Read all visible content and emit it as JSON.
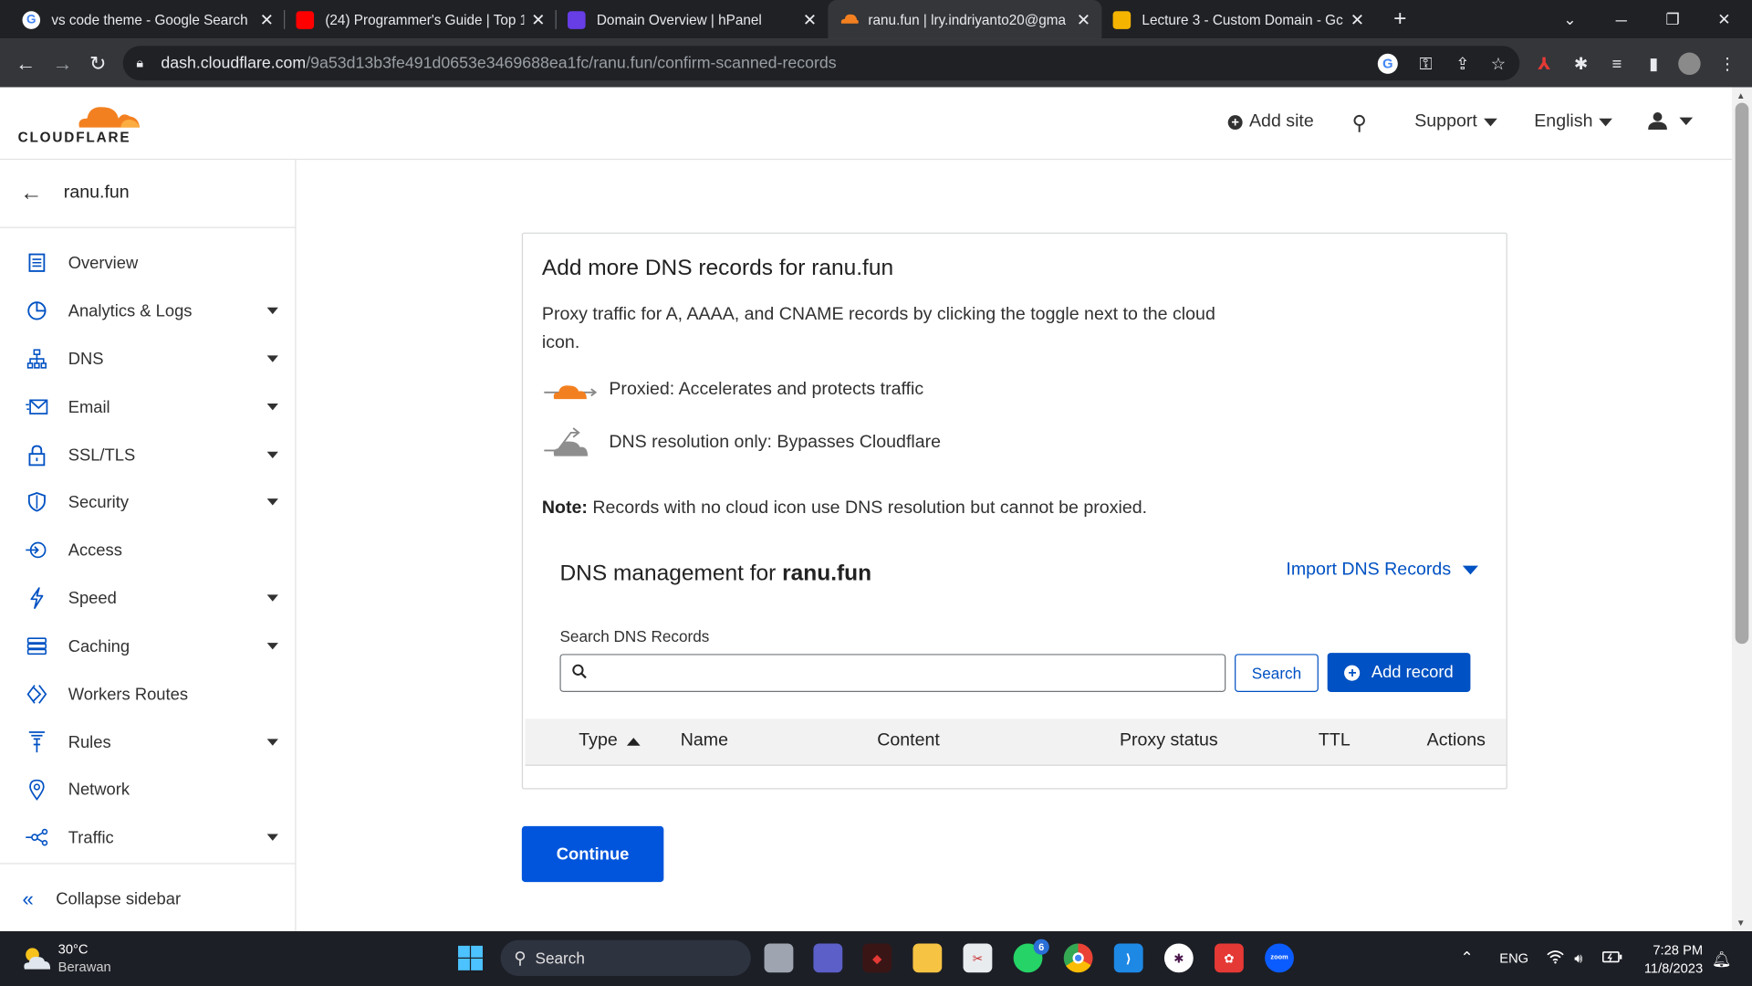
{
  "browser": {
    "tabs": [
      {
        "title": "vs code theme - Google Search",
        "icon": "google-icon",
        "color": "#ffffff"
      },
      {
        "title": "(24) Programmer's Guide | Top 1",
        "icon": "youtube-icon",
        "color": "#ff0000"
      },
      {
        "title": "Domain Overview | hPanel",
        "icon": "hostinger-icon",
        "color": "#673de6"
      },
      {
        "title": "ranu.fun | lry.indriyanto20@gma",
        "icon": "cloudflare-icon",
        "color": "#f38020",
        "active": true
      },
      {
        "title": "Lecture 3 - Custom Domain - Gc",
        "icon": "slides-icon",
        "color": "#f4b400"
      }
    ],
    "url_domain": "dash.cloudflare.com",
    "url_path": "/9a53d13b3fe491d0653e3469688ea1fc/ranu.fun/confirm-scanned-records"
  },
  "header": {
    "logo_text": "CLOUDFLARE",
    "add_site": "Add site",
    "support": "Support",
    "language": "English"
  },
  "sidebar": {
    "site": "ranu.fun",
    "items": [
      {
        "label": "Overview",
        "icon": "overview-icon",
        "dropdown": false
      },
      {
        "label": "Analytics & Logs",
        "icon": "analytics-icon",
        "dropdown": true
      },
      {
        "label": "DNS",
        "icon": "dns-icon",
        "dropdown": true
      },
      {
        "label": "Email",
        "icon": "email-icon",
        "dropdown": true
      },
      {
        "label": "SSL/TLS",
        "icon": "lock-icon",
        "dropdown": true
      },
      {
        "label": "Security",
        "icon": "shield-icon",
        "dropdown": true
      },
      {
        "label": "Access",
        "icon": "access-icon",
        "dropdown": false
      },
      {
        "label": "Speed",
        "icon": "bolt-icon",
        "dropdown": true
      },
      {
        "label": "Caching",
        "icon": "caching-icon",
        "dropdown": true
      },
      {
        "label": "Workers Routes",
        "icon": "workers-icon",
        "dropdown": false
      },
      {
        "label": "Rules",
        "icon": "rules-icon",
        "dropdown": true
      },
      {
        "label": "Network",
        "icon": "location-pin-icon",
        "dropdown": false
      },
      {
        "label": "Traffic",
        "icon": "traffic-icon",
        "dropdown": true
      }
    ],
    "collapse": "Collapse sidebar"
  },
  "main": {
    "title": "Add more DNS records for ranu.fun",
    "description": "Proxy traffic for A, AAAA, and CNAME records by clicking the toggle next to the cloud icon.",
    "proxied": "Proxied: Accelerates and protects traffic",
    "dns_only": "DNS resolution only: Bypasses Cloudflare",
    "note_label": "Note:",
    "note_text": " Records with no cloud icon use DNS resolution but cannot be proxied.",
    "dns_mgmt_prefix": "DNS management for ",
    "dns_mgmt_domain": "ranu.fun",
    "import": "Import DNS Records",
    "search_label": "Search DNS Records",
    "search_value": "",
    "search_button": "Search",
    "add_record": "Add record",
    "columns": [
      "Type",
      "Name",
      "Content",
      "Proxy status",
      "TTL",
      "Actions"
    ],
    "continue": "Continue"
  },
  "taskbar": {
    "temp": "30°C",
    "weather": "Berawan",
    "search": "Search",
    "lang": "ENG",
    "time": "7:28 PM",
    "date": "11/8/2023",
    "whatsapp_badge": "6"
  },
  "colors": {
    "accent": "#0051c3",
    "cloud_orange": "#f38020",
    "continue_button": "#0055dc"
  }
}
